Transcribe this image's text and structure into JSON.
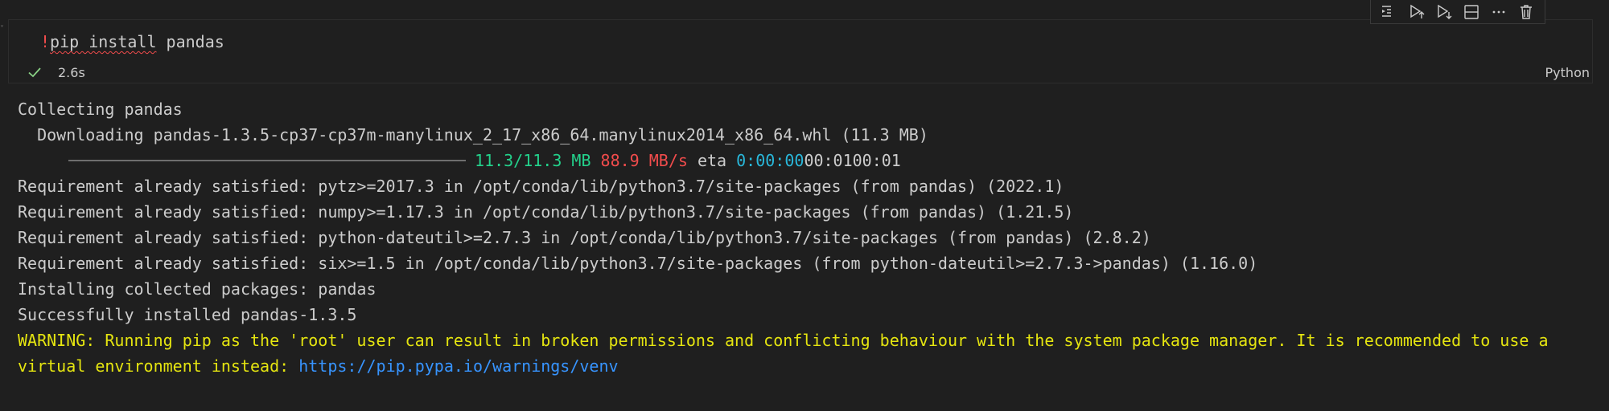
{
  "cell": {
    "code_prefix": "!",
    "code_command": "pip install",
    "code_rest": " pandas",
    "exec_time": "2.6s",
    "language": "Python"
  },
  "toolbar": {
    "icons": [
      "run-above-icon",
      "run-cell-icon",
      "run-below-icon",
      "split-cell-icon",
      "more-icon",
      "delete-icon"
    ]
  },
  "output": {
    "line1": "Collecting pandas",
    "line2": "  Downloading pandas-1.3.5-cp37-cp37m-manylinux_2_17_x86_64.manylinux2014_x86_64.whl (11.3 MB)",
    "progress": {
      "size": "11.3/11.3 MB",
      "speed": "88.9 MB/s",
      "eta_label": "eta",
      "eta_value": "0:00:00",
      "eta_trail": "00:0100:01",
      "fraction": 1.0
    },
    "req1": "Requirement already satisfied: pytz>=2017.3 in /opt/conda/lib/python3.7/site-packages (from pandas) (2022.1)",
    "req2": "Requirement already satisfied: numpy>=1.17.3 in /opt/conda/lib/python3.7/site-packages (from pandas) (1.21.5)",
    "req3": "Requirement already satisfied: python-dateutil>=2.7.3 in /opt/conda/lib/python3.7/site-packages (from pandas) (2.8.2)",
    "req4": "Requirement already satisfied: six>=1.5 in /opt/conda/lib/python3.7/site-packages (from python-dateutil>=2.7.3->pandas) (1.16.0)",
    "installing": "Installing collected packages: pandas",
    "success": "Successfully installed pandas-1.3.5",
    "warning1": "WARNING: Running pip as the 'root' user can result in broken permissions and conflicting behaviour with the system package manager. It is recommended to use a",
    "warning2_prefix": "virtual environment instead: ",
    "warning_link": "https://pip.pypa.io/warnings/venv"
  },
  "colors": {
    "background": "#1f1f1f",
    "text": "#cccccc",
    "green": "#23d18b",
    "red": "#f14c4c",
    "cyan": "#29b8db",
    "yellow": "#e5e510",
    "link": "#3794ff"
  }
}
